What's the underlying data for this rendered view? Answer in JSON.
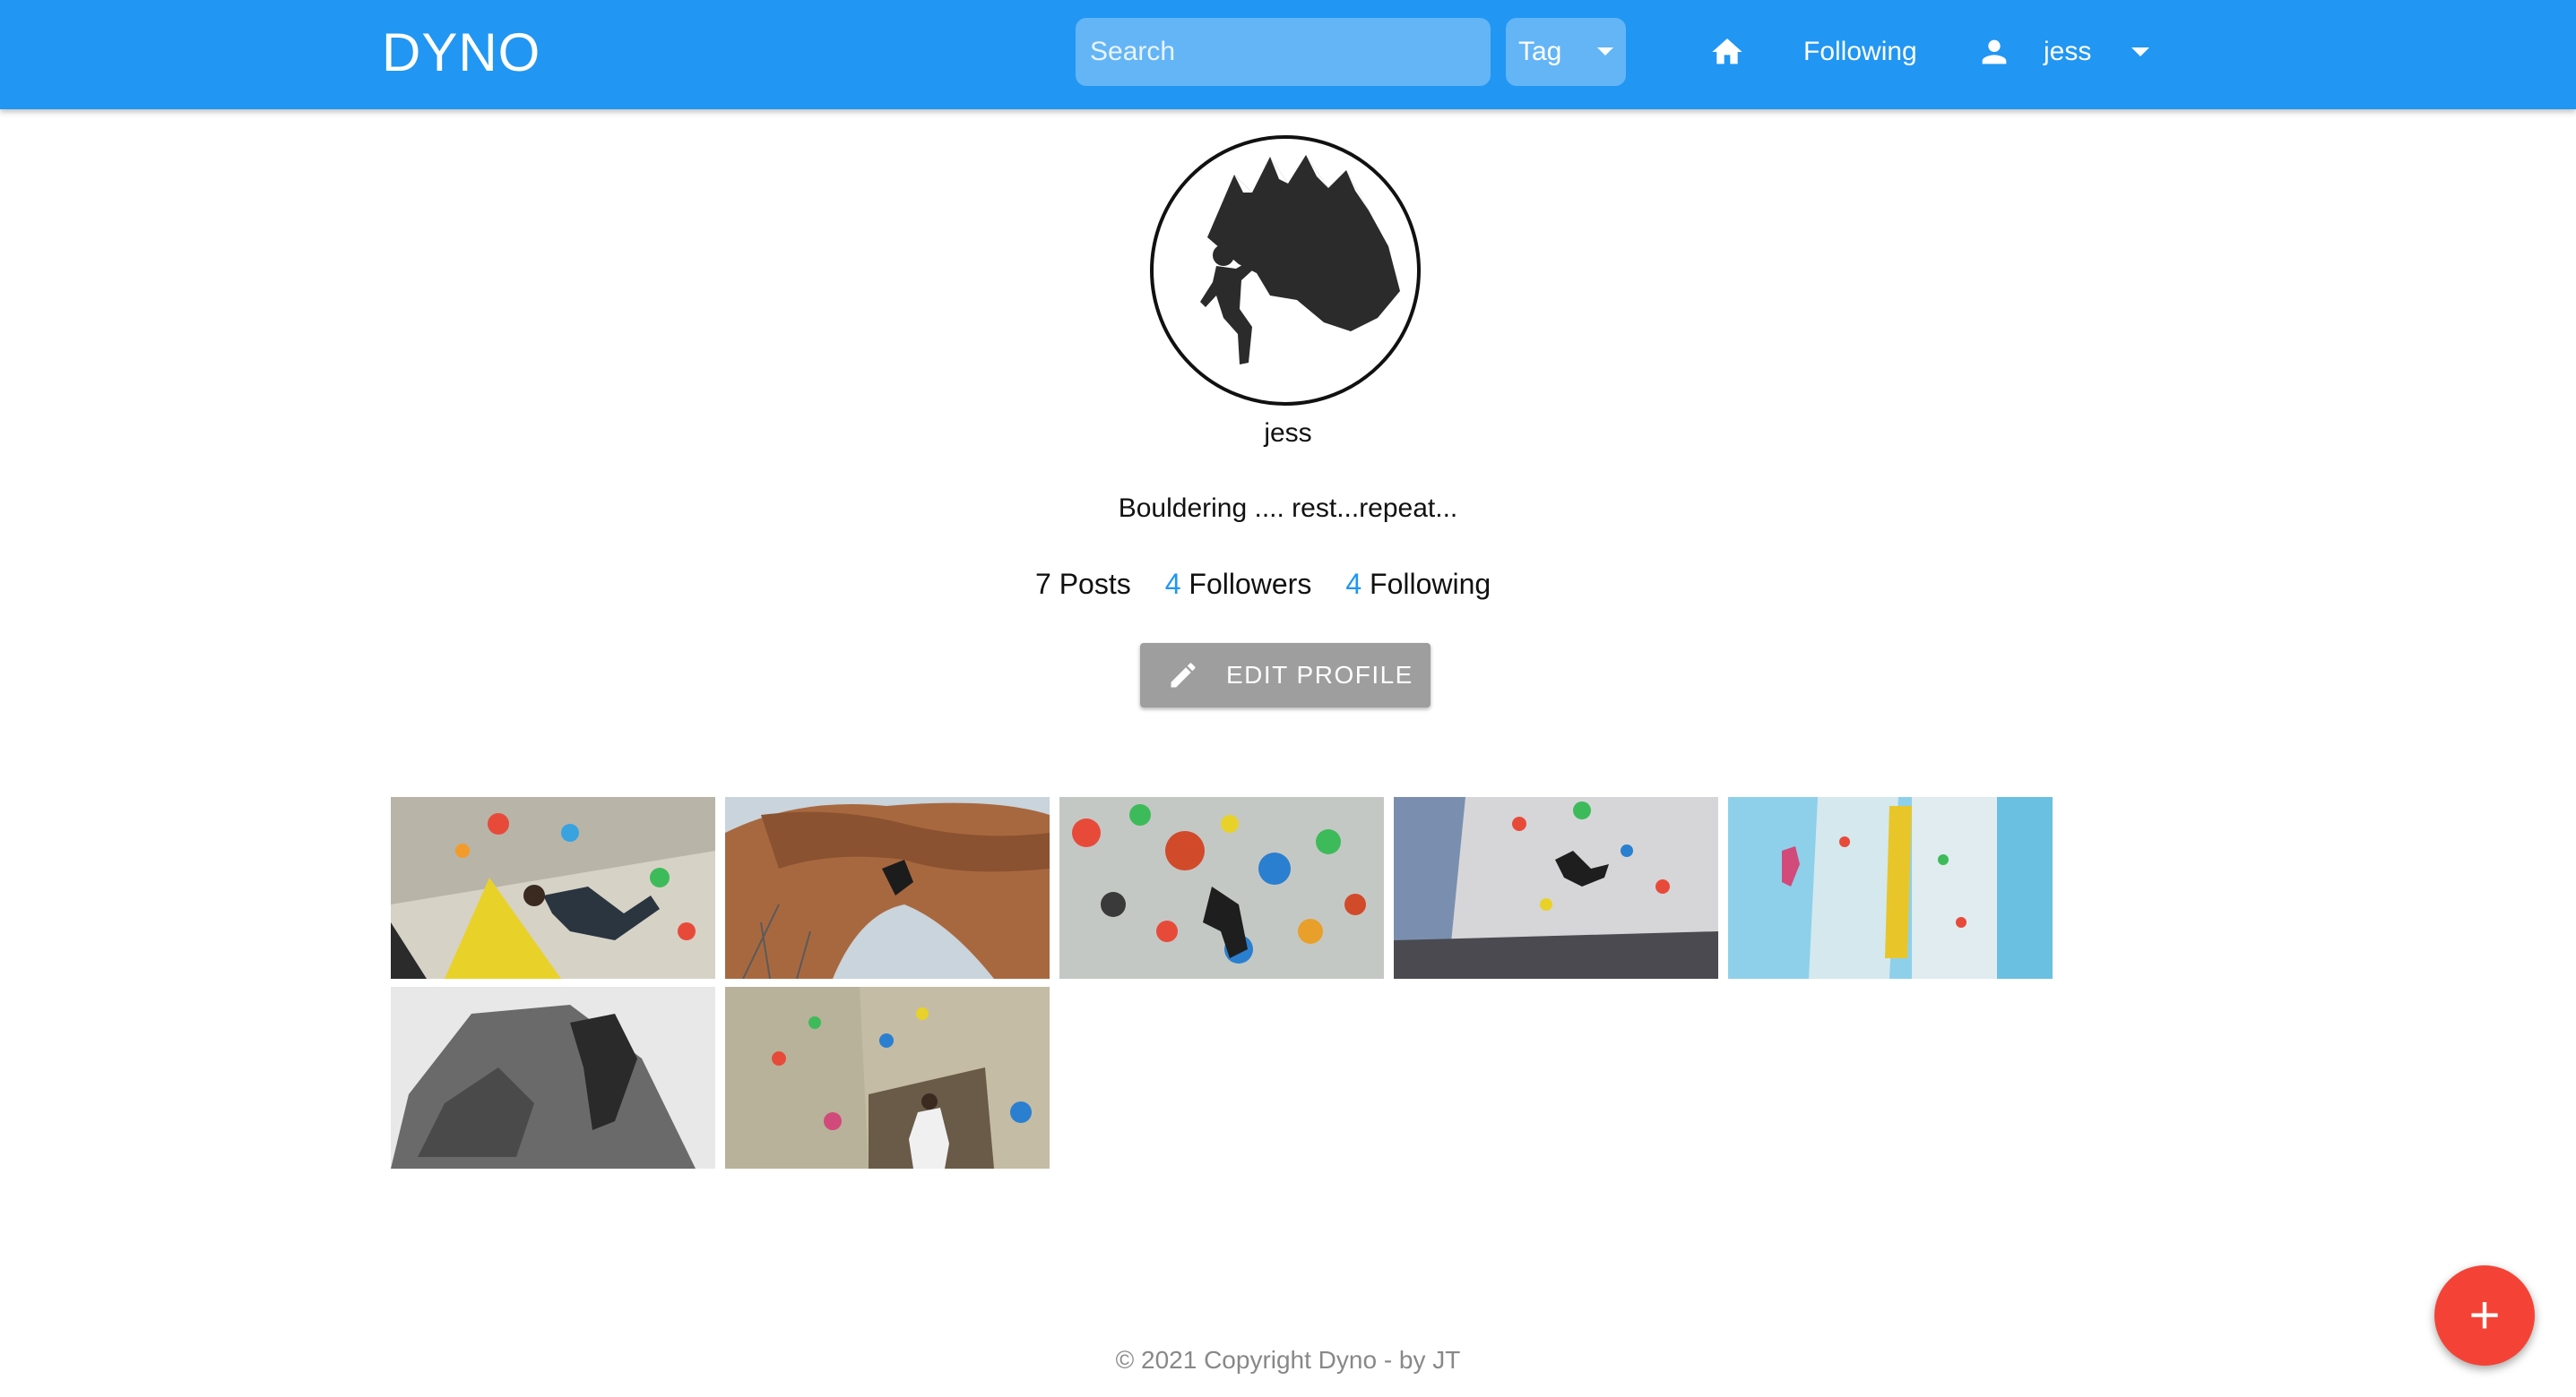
{
  "nav": {
    "brand": "DYNO",
    "search_placeholder": "Search",
    "tag_label": "Tag",
    "following_label": "Following",
    "user_label": "jess",
    "color": "#2196f3"
  },
  "profile": {
    "username": "jess",
    "bio": "Bouldering .... rest...repeat...",
    "posts_count": "7",
    "posts_label": "Posts",
    "followers_count": "4",
    "followers_label": "Followers",
    "following_count": "4",
    "following_label": "Following",
    "edit_button": "EDIT PROFILE"
  },
  "posts": [
    {
      "id": "post-1",
      "theme": "indoor-colorful-wall"
    },
    {
      "id": "post-2",
      "theme": "outdoor-rock-overhang"
    },
    {
      "id": "post-3",
      "theme": "indoor-holds-closeup"
    },
    {
      "id": "post-4",
      "theme": "indoor-grey-wall"
    },
    {
      "id": "post-5",
      "theme": "indoor-blue-wall"
    },
    {
      "id": "post-6",
      "theme": "outdoor-bw-boulder"
    },
    {
      "id": "post-7",
      "theme": "indoor-tan-wall"
    }
  ],
  "fab": {
    "label": "+",
    "color": "#f44336"
  },
  "footer": "© 2021 Copyright Dyno - by JT"
}
